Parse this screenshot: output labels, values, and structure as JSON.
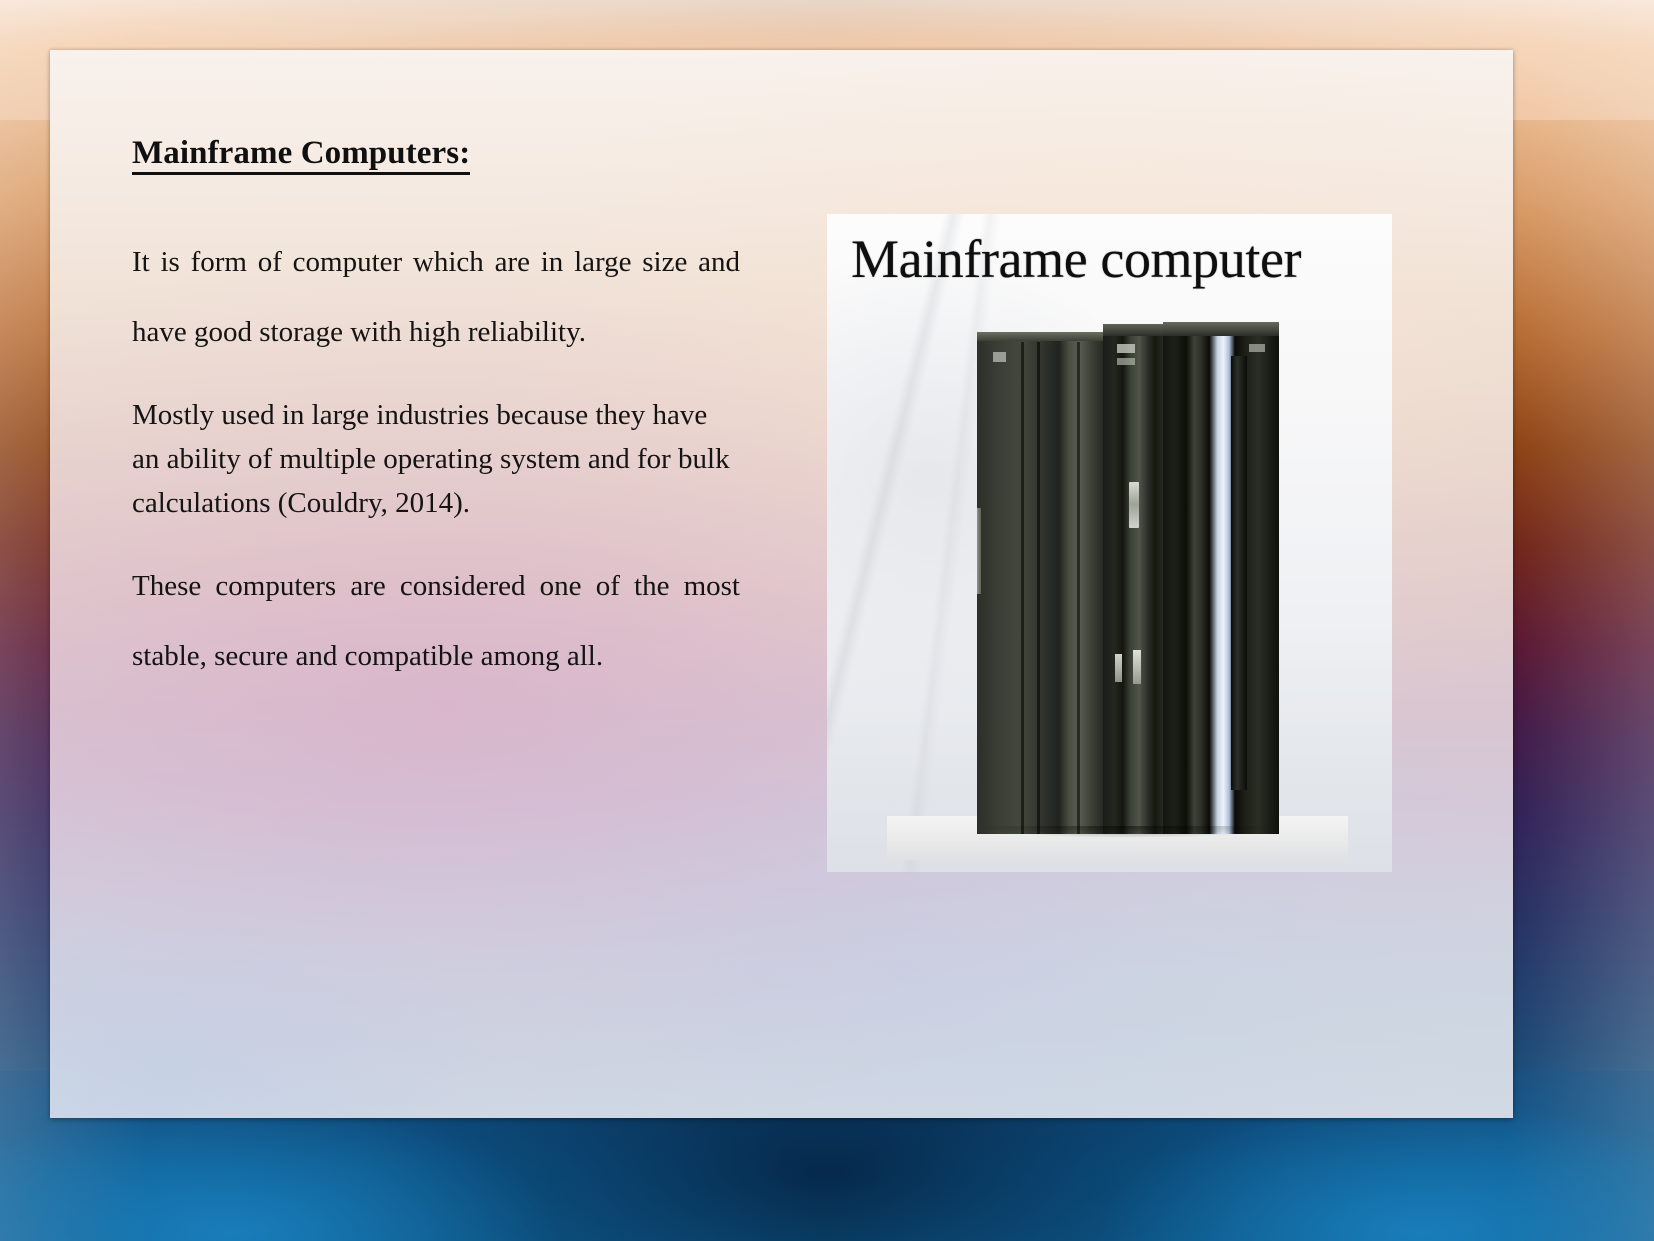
{
  "slide": {
    "heading": "Mainframe Computers:",
    "paragraphs": [
      "It is form of computer which are in large size and have good storage with high reliability.",
      "Mostly used in large industries because they have an ability of multiple operating system and for bulk calculations (Couldry, 2014).",
      "These computers are considered one of the most stable, secure and compatible among all."
    ],
    "picture": {
      "title": "Mainframe computer",
      "alt": "Photograph of two tall dark mainframe computer cabinets standing side by side against a light wall"
    },
    "colors": {
      "text": "#141414",
      "heading": "#101010",
      "frame_top": "#f2c9a4",
      "frame_mid": "#8a3d0d",
      "frame_bottom": "#0d5f91",
      "canvas_top": "#f8f1ec",
      "canvas_bottom": "#d1dae4",
      "rack_dark": "#2b2f28",
      "rack_light_strip": "#eef3fb"
    }
  }
}
